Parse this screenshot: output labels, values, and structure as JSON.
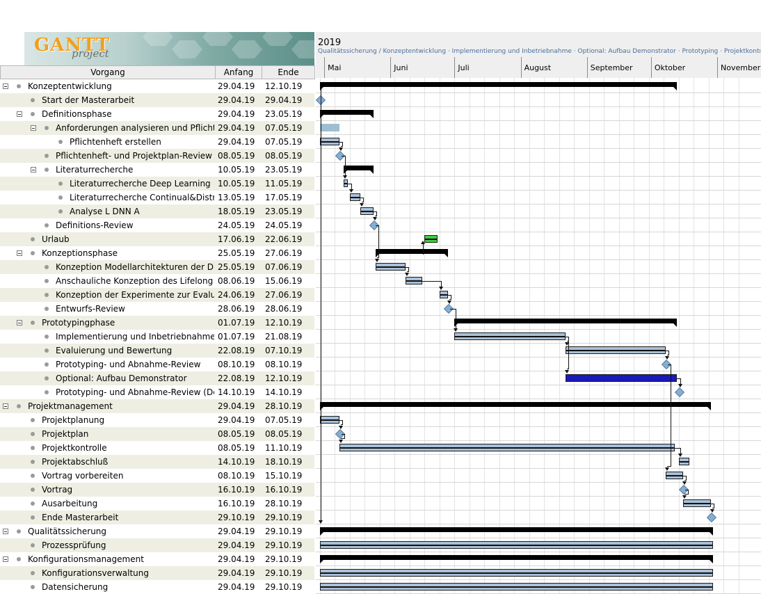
{
  "logo": {
    "text": "GANTT",
    "sub": "project"
  },
  "table": {
    "col_task": "Vorgang",
    "col_start": "Anfang",
    "col_end": "Ende"
  },
  "tasks": [
    {
      "name": "Konzeptentwicklung",
      "start": "29.04.19",
      "end": "12.10.19"
    },
    {
      "name": "Start der Masterarbeit",
      "start": "29.04.19",
      "end": "29.04.19"
    },
    {
      "name": "Definitionsphase",
      "start": "29.04.19",
      "end": "23.05.19"
    },
    {
      "name": "Anforderungen analysieren und Pflichten...",
      "start": "29.04.19",
      "end": "07.05.19"
    },
    {
      "name": "Pflichtenheft erstellen",
      "start": "29.04.19",
      "end": "07.05.19"
    },
    {
      "name": "Pflichtenheft- und Projektplan-Review",
      "start": "08.05.19",
      "end": "08.05.19"
    },
    {
      "name": "Literaturrecherche",
      "start": "10.05.19",
      "end": "23.05.19"
    },
    {
      "name": "Literaturrecherche Deep Learning",
      "start": "10.05.19",
      "end": "11.05.19"
    },
    {
      "name": "Literaturrecherche Continual&Distrib...",
      "start": "13.05.19",
      "end": "17.05.19"
    },
    {
      "name": "Analyse L DNN A",
      "start": "18.05.19",
      "end": "23.05.19"
    },
    {
      "name": "Definitions-Review",
      "start": "24.05.19",
      "end": "24.05.19"
    },
    {
      "name": "Urlaub",
      "start": "17.06.19",
      "end": "22.06.19"
    },
    {
      "name": "Konzeptionsphase",
      "start": "25.05.19",
      "end": "27.06.19"
    },
    {
      "name": "Konzeption Modellarchitekturen der DNNs",
      "start": "25.05.19",
      "end": "07.06.19"
    },
    {
      "name": "Anschauliche Konzeption des Lifelong D...",
      "start": "08.06.19",
      "end": "15.06.19"
    },
    {
      "name": "Konzeption der Experimente zur Evaluieru...",
      "start": "24.06.19",
      "end": "27.06.19"
    },
    {
      "name": "Entwurfs-Review",
      "start": "28.06.19",
      "end": "28.06.19"
    },
    {
      "name": "Prototypingphase",
      "start": "01.07.19",
      "end": "12.10.19"
    },
    {
      "name": "Implementierung und Inbetriebnahme",
      "start": "01.07.19",
      "end": "21.08.19"
    },
    {
      "name": "Evaluierung und Bewertung",
      "start": "22.08.19",
      "end": "07.10.19"
    },
    {
      "name": "Prototyping- und Abnahme-Review",
      "start": "08.10.19",
      "end": "08.10.19"
    },
    {
      "name": "Optional: Aufbau Demonstrator",
      "start": "22.08.19",
      "end": "12.10.19"
    },
    {
      "name": "Prototyping- und Abnahme-Review (De...",
      "start": "14.10.19",
      "end": "14.10.19"
    },
    {
      "name": "Projektmanagement",
      "start": "29.04.19",
      "end": "28.10.19"
    },
    {
      "name": "Projektplanung",
      "start": "29.04.19",
      "end": "07.05.19"
    },
    {
      "name": "Projektplan",
      "start": "08.05.19",
      "end": "08.05.19"
    },
    {
      "name": "Projektkontrolle",
      "start": "08.05.19",
      "end": "11.10.19"
    },
    {
      "name": "Projektabschluß",
      "start": "14.10.19",
      "end": "18.10.19"
    },
    {
      "name": "Vortrag vorbereiten",
      "start": "08.10.19",
      "end": "15.10.19"
    },
    {
      "name": "Vortrag",
      "start": "16.10.19",
      "end": "16.10.19"
    },
    {
      "name": "Ausarbeitung",
      "start": "16.10.19",
      "end": "28.10.19"
    },
    {
      "name": "Ende Masterarbeit",
      "start": "29.10.19",
      "end": "29.10.19"
    },
    {
      "name": "Qualitätssicherung",
      "start": "29.04.19",
      "end": "29.10.19"
    },
    {
      "name": "Prozessprüfung",
      "start": "29.04.19",
      "end": "29.10.19"
    },
    {
      "name": "Konfigurationsmanagement",
      "start": "29.04.19",
      "end": "29.10.19"
    },
    {
      "name": "Konfigurationsverwaltung",
      "start": "29.04.19",
      "end": "29.10.19"
    },
    {
      "name": "Datensicherung",
      "start": "29.04.19",
      "end": "29.10.19"
    }
  ],
  "chart": {
    "year": "2019",
    "notes_line": "Qualitätssicherung / Konzeptentwicklung · Implementierung und Inbetriebnahme · Optional: Aufbau Demonstrator · Prototyping · Projektkontrolle",
    "months": [
      "Mai",
      "Juni",
      "Juli",
      "August",
      "September",
      "Oktober",
      "November"
    ],
    "colors": {
      "task_bar": "#a9c0d8",
      "vacation": "#3dcf3d",
      "optional": "#1a1ab8",
      "summary": "#000000",
      "milestone": "#86aed0",
      "row_alt": "#eeeee3"
    }
  }
}
